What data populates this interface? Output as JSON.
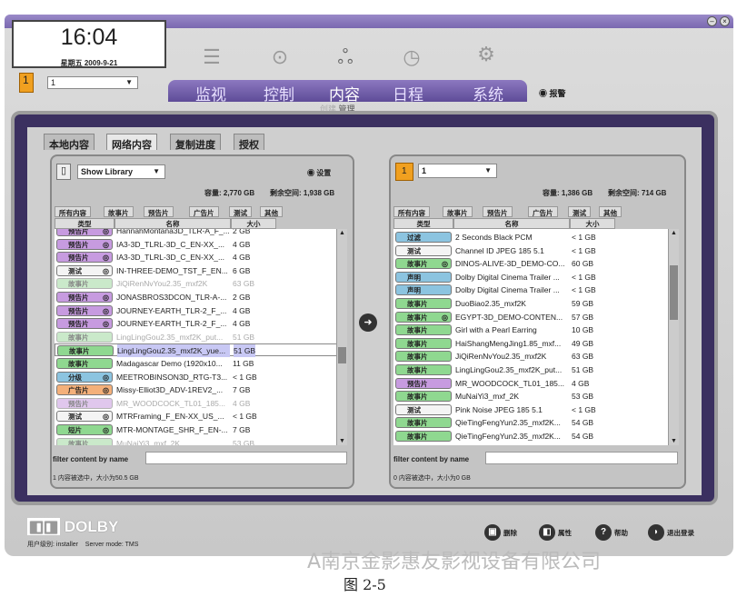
{
  "clock": {
    "time": "16:04",
    "date": "星期五 2009-9-21"
  },
  "channel": {
    "number": "1",
    "selected": "1"
  },
  "nav": {
    "tabs": [
      "监视",
      "控制",
      "内容",
      "日程",
      "系统"
    ],
    "active": "内容",
    "sub": [
      "创建",
      "管理"
    ],
    "alarm": "报警"
  },
  "content_tabs": [
    "本地内容",
    "网络内容",
    "复制进度",
    "授权"
  ],
  "left": {
    "library": "Show Library",
    "settings": "设置",
    "capacity": "容量: 2,770 GB",
    "free": "剩余空间: 1,938 GB",
    "cat_tabs": [
      "所有内容",
      "故事片",
      "预告片",
      "广告片",
      "测试",
      "其他"
    ],
    "headers": [
      "类型",
      "名称",
      "大小"
    ],
    "rows": [
      {
        "type": "预告片",
        "c": "#c79be0",
        "name": "HannahMontana3D_TLR-A_F_...",
        "size": "2 GB",
        "d3": true
      },
      {
        "type": "预告片",
        "c": "#c79be0",
        "name": "IA3-3D_TLRL-3D_C_EN-XX_...",
        "size": "4 GB",
        "d3": true
      },
      {
        "type": "预告片",
        "c": "#c79be0",
        "name": "IA3-3D_TLRL-3D_C_EN-XX_...",
        "size": "4 GB",
        "d3": true
      },
      {
        "type": "测试",
        "c": "#f4f4f4",
        "name": "IN-THREE-DEMO_TST_F_EN...",
        "size": "6 GB",
        "d3": true
      },
      {
        "type": "故事片",
        "c": "#9fd8a0",
        "name": "JiQiRenNvYou2.35_mxf2K",
        "size": "63 GB",
        "dim": true
      },
      {
        "type": "预告片",
        "c": "#c79be0",
        "name": "JONASBROS3DCON_TLR-A-...",
        "size": "2 GB",
        "d3": true
      },
      {
        "type": "预告片",
        "c": "#c79be0",
        "name": "JOURNEY-EARTH_TLR-2_F_...",
        "size": "4 GB",
        "d3": true
      },
      {
        "type": "预告片",
        "c": "#c79be0",
        "name": "JOURNEY-EARTH_TLR-2_F_...",
        "size": "4 GB",
        "d3": true
      },
      {
        "type": "故事片",
        "c": "#9fd8a0",
        "name": "LingLingGou2.35_mxf2K_put...",
        "size": "51 GB",
        "dim": true
      },
      {
        "type": "故事片",
        "c": "#8fd890",
        "name": "LingLingGou2.35_mxf2K_yue...",
        "size": "51 GB",
        "sel": true
      },
      {
        "type": "故事片",
        "c": "#8fd890",
        "name": "Madagascar Demo (1920x10...",
        "size": "11 GB"
      },
      {
        "type": "分级",
        "c": "#8cc4e0",
        "name": "MEETROBINSON3D_RTG-T3...",
        "size": "< 1 GB",
        "d3": true
      },
      {
        "type": "广告片",
        "c": "#f4b07a",
        "name": "Missy-Elliot3D_ADV-1REV2_...",
        "size": "7 GB",
        "d3": true
      },
      {
        "type": "预告片",
        "c": "#c79be0",
        "name": "MR_WOODCOCK_TL01_185...",
        "size": "4 GB",
        "dim": true
      },
      {
        "type": "测试",
        "c": "#f4f4f4",
        "name": "MTRFraming_F_EN-XX_US_...",
        "size": "< 1 GB",
        "d3": true
      },
      {
        "type": "短片",
        "c": "#8fd890",
        "name": "MTR-MONTAGE_SHR_F_EN-...",
        "size": "7 GB",
        "d3": true
      },
      {
        "type": "故事片",
        "c": "#9fd8a0",
        "name": "MuNaiYi3_mxf_2K",
        "size": "53 GB",
        "dim": true
      }
    ],
    "filter_label": "filter content by name",
    "status": "1 内容被选中，大小为50.5 GB"
  },
  "right": {
    "channel": "1",
    "selected": "1",
    "capacity": "容量: 1,386 GB",
    "free": "剩余空间: 714 GB",
    "cat_tabs": [
      "所有内容",
      "故事片",
      "预告片",
      "广告片",
      "测试",
      "其他"
    ],
    "headers": [
      "类型",
      "名称",
      "大小"
    ],
    "rows": [
      {
        "type": "过滤",
        "c": "#8cc4e0",
        "name": "2 Seconds Black PCM",
        "size": "< 1 GB"
      },
      {
        "type": "测试",
        "c": "#f4f4f4",
        "name": "Channel ID JPEG 185 5.1",
        "size": "< 1 GB"
      },
      {
        "type": "故事片",
        "c": "#8fd890",
        "name": "DINOS-ALIVE-3D_DEMO-CO...",
        "size": "60 GB",
        "d3": true
      },
      {
        "type": "声明",
        "c": "#8cc4e0",
        "name": "Dolby Digital Cinema Trailer ...",
        "size": "< 1 GB"
      },
      {
        "type": "声明",
        "c": "#8cc4e0",
        "name": "Dolby Digital Cinema Trailer ...",
        "size": "< 1 GB"
      },
      {
        "type": "故事片",
        "c": "#8fd890",
        "name": "DuoBiao2.35_mxf2K",
        "size": "59 GB"
      },
      {
        "type": "故事片",
        "c": "#8fd890",
        "name": "EGYPT-3D_DEMO-CONTEN...",
        "size": "57 GB",
        "d3": true
      },
      {
        "type": "故事片",
        "c": "#8fd890",
        "name": "Girl with a Pearl Earring",
        "size": "10 GB"
      },
      {
        "type": "故事片",
        "c": "#8fd890",
        "name": "HaiShangMengJing1.85_mxf...",
        "size": "49 GB"
      },
      {
        "type": "故事片",
        "c": "#8fd890",
        "name": "JiQiRenNvYou2.35_mxf2K",
        "size": "63 GB"
      },
      {
        "type": "故事片",
        "c": "#8fd890",
        "name": "LingLingGou2.35_mxf2K_put...",
        "size": "51 GB"
      },
      {
        "type": "预告片",
        "c": "#c79be0",
        "name": "MR_WOODCOCK_TL01_185...",
        "size": "4 GB"
      },
      {
        "type": "故事片",
        "c": "#8fd890",
        "name": "MuNaiYi3_mxf_2K",
        "size": "53 GB"
      },
      {
        "type": "测试",
        "c": "#f4f4f4",
        "name": "Pink Noise JPEG 185 5.1",
        "size": "< 1 GB"
      },
      {
        "type": "故事片",
        "c": "#8fd890",
        "name": "QieTingFengYun2.35_mxf2K...",
        "size": "54 GB"
      },
      {
        "type": "故事片",
        "c": "#8fd890",
        "name": "QieTingFengYun2.35_mxf2K...",
        "size": "54 GB"
      }
    ],
    "filter_label": "filter content by name",
    "status": "0 内容被选中，大小为0 GB"
  },
  "footer": {
    "brand": "DOLBY",
    "user": "用户级别: installer",
    "server": "Server mode: TMS",
    "buttons": [
      {
        "label": "删除",
        "icon": "trash-icon",
        "g": "▣"
      },
      {
        "label": "属性",
        "icon": "properties-icon",
        "g": "◧"
      },
      {
        "label": "帮助",
        "icon": "help-icon",
        "g": "?"
      },
      {
        "label": "退出登录",
        "icon": "logout-icon",
        "g": "◗"
      }
    ]
  },
  "watermark": "A南京金影惠友影视设备有限公司",
  "caption": "图 2-5"
}
